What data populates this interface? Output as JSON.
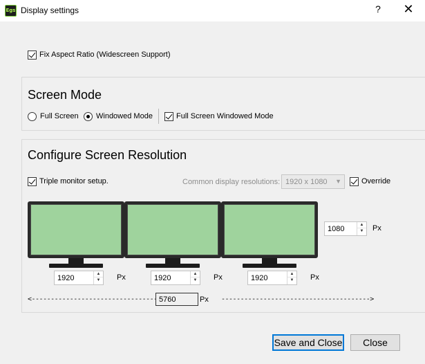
{
  "window": {
    "title": "Display settings",
    "help_label": "?",
    "close_label": "✕",
    "app_icon_text": "Egs"
  },
  "aspect": {
    "label": "Fix Aspect Ratio (Widescreen Support)",
    "checked": true
  },
  "screen_mode": {
    "title": "Screen Mode",
    "full_screen_label": "Full Screen",
    "windowed_label": "Windowed Mode",
    "fullscreen_windowed_label": "Full Screen Windowed Mode",
    "selected": "Windowed Mode",
    "fullscreen_windowed_checked": true
  },
  "resolution": {
    "title": "Configure Screen Resolution",
    "triple_label": "Triple monitor setup.",
    "triple_checked": true,
    "common_label": "Common display resolutions:",
    "common_value": "1920 x 1080",
    "override_label": "Override",
    "override_checked": true,
    "height_value": "1080",
    "unit": "Px",
    "widths": [
      "1920",
      "1920",
      "1920"
    ],
    "total_width": "5760",
    "dash_left": "<------------------------------------------",
    "dash_right": "--------------------------------------->"
  },
  "buttons": {
    "save_label": "Save and Close",
    "close_label": "Close"
  },
  "colors": {
    "screen_green": "#9fd39d",
    "accent_blue": "#0078d7"
  }
}
